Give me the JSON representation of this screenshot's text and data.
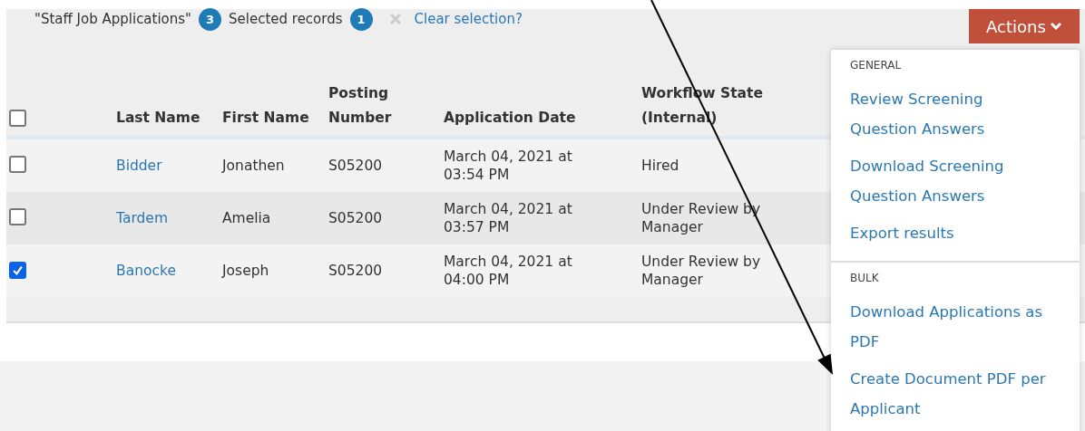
{
  "selection_bar": {
    "list_name": "\"Staff Job Applications\"",
    "list_count": "3",
    "selected_label": "Selected records",
    "selected_count": "1",
    "clear_link": "Clear selection?"
  },
  "actions_button": {
    "label": "Actions"
  },
  "table": {
    "select_all": {
      "checked": false
    },
    "columns": [
      "Last Name",
      "First Name",
      "Posting Number",
      "Application Date",
      "Workflow State (Internal)"
    ],
    "rows": [
      {
        "selected": false,
        "last_name": "Bidder",
        "first_name": "Jonathen",
        "posting_number": "S05200",
        "application_date": "March 04, 2021 at 03:54 PM",
        "workflow_state": "Hired"
      },
      {
        "selected": false,
        "last_name": "Tardem",
        "first_name": "Amelia",
        "posting_number": "S05200",
        "application_date": "March 04, 2021 at 03:57 PM",
        "workflow_state": "Under Review by Manager"
      },
      {
        "selected": true,
        "last_name": "Banocke",
        "first_name": "Joseph",
        "posting_number": "S05200",
        "application_date": "March 04, 2021 at 04:00 PM",
        "workflow_state": "Under Review by Manager"
      }
    ]
  },
  "actions_menu": {
    "sections": [
      {
        "heading": "GENERAL",
        "items": [
          "Review Screening Question Answers",
          "Download Screening Question Answers",
          "Export results"
        ]
      },
      {
        "heading": "BULK",
        "items": [
          "Download Applications as PDF",
          "Create Document PDF per Applicant"
        ]
      }
    ]
  }
}
